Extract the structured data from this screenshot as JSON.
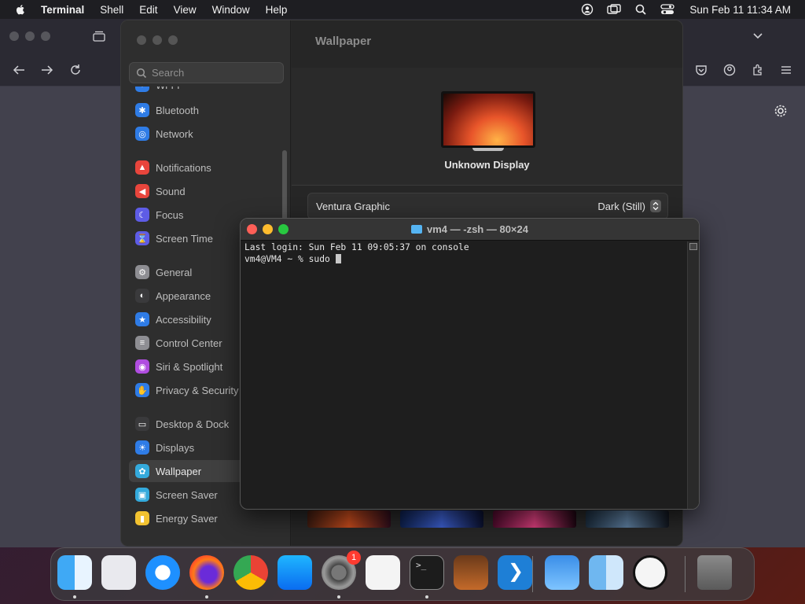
{
  "menubar": {
    "app_name": "Terminal",
    "items": [
      "Shell",
      "Edit",
      "View",
      "Window",
      "Help"
    ],
    "clock": "Sun Feb 11  11:34 AM",
    "status_icons": [
      "user-icon",
      "screen-mirror-icon",
      "search-icon",
      "control-center-icon"
    ]
  },
  "settings": {
    "search_placeholder": "Search",
    "page_title": "Wallpaper",
    "display_name": "Unknown Display",
    "wallpaper_name": "Ventura Graphic",
    "wallpaper_style": "Dark (Still)",
    "sidebar_items": [
      {
        "label": "Wi-Fi",
        "icon": "wifi-icon",
        "color": "#2f7ce6"
      },
      {
        "label": "Bluetooth",
        "icon": "bluetooth-icon",
        "color": "#2f7ce6"
      },
      {
        "label": "Network",
        "icon": "globe-icon",
        "color": "#2f7ce6"
      },
      {
        "label": "Notifications",
        "icon": "bell-icon",
        "color": "#e8453c"
      },
      {
        "label": "Sound",
        "icon": "speaker-icon",
        "color": "#e8453c"
      },
      {
        "label": "Focus",
        "icon": "moon-icon",
        "color": "#5e5ce6"
      },
      {
        "label": "Screen Time",
        "icon": "hourglass-icon",
        "color": "#5e5ce6"
      },
      {
        "label": "General",
        "icon": "gear-icon",
        "color": "#8e8e93"
      },
      {
        "label": "Appearance",
        "icon": "appearance-icon",
        "color": "#3a3a3c"
      },
      {
        "label": "Accessibility",
        "icon": "accessibility-icon",
        "color": "#2f7ce6"
      },
      {
        "label": "Control Center",
        "icon": "control-center-icon",
        "color": "#8e8e93"
      },
      {
        "label": "Siri & Spotlight",
        "icon": "siri-icon",
        "color": "#b04de0"
      },
      {
        "label": "Privacy & Security",
        "icon": "hand-icon",
        "color": "#2f7ce6"
      },
      {
        "label": "Desktop & Dock",
        "icon": "desktop-icon",
        "color": "#3a3a3c"
      },
      {
        "label": "Displays",
        "icon": "displays-icon",
        "color": "#2f7ce6"
      },
      {
        "label": "Wallpaper",
        "icon": "wallpaper-icon",
        "color": "#34aadc"
      },
      {
        "label": "Screen Saver",
        "icon": "screensaver-icon",
        "color": "#34aadc"
      },
      {
        "label": "Energy Saver",
        "icon": "battery-icon",
        "color": "#f2c230"
      }
    ],
    "selected_item": "Wallpaper"
  },
  "terminal": {
    "title": "vm4 — -zsh — 80×24",
    "lines": [
      "Last login: Sun Feb 11 09:05:37 on console",
      "vm4@VM4 ~ % sudo "
    ]
  },
  "dock": {
    "apps": [
      {
        "name": "Finder",
        "icon": "finder-icon",
        "running": true
      },
      {
        "name": "Launchpad",
        "icon": "launchpad-icon",
        "running": false
      },
      {
        "name": "Safari",
        "icon": "safari-icon",
        "running": false
      },
      {
        "name": "Firefox",
        "icon": "firefox-icon",
        "running": true
      },
      {
        "name": "Chrome",
        "icon": "chrome-icon",
        "running": false
      },
      {
        "name": "App Store",
        "icon": "app-store-icon",
        "running": false
      },
      {
        "name": "System Settings",
        "icon": "system-settings-icon",
        "running": true,
        "badge": "1"
      },
      {
        "name": "TextEdit",
        "icon": "textedit-icon",
        "running": false
      },
      {
        "name": "Terminal",
        "icon": "terminal-icon",
        "running": true
      },
      {
        "name": "GarageBand",
        "icon": "garageband-icon",
        "running": false
      },
      {
        "name": "Visual Studio Code",
        "icon": "vscode-icon",
        "running": false
      },
      {
        "name": "Weather",
        "icon": "weather-icon",
        "running": false
      },
      {
        "name": "Finder",
        "icon": "finder-icon",
        "running": false
      },
      {
        "name": "Clock",
        "icon": "clock-icon",
        "running": false
      },
      {
        "name": "Trash",
        "icon": "trash-icon",
        "running": false
      }
    ]
  }
}
